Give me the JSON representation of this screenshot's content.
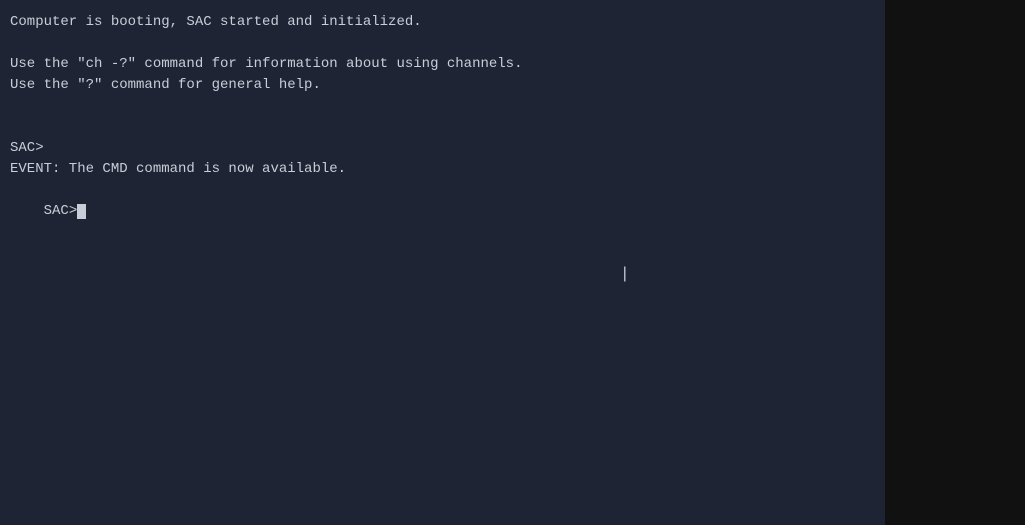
{
  "terminal": {
    "background": "#1e2433",
    "right_panel_background": "#111111",
    "lines": [
      {
        "id": "line1",
        "text": "Computer is booting, SAC started and initialized."
      },
      {
        "id": "line2",
        "text": ""
      },
      {
        "id": "line3",
        "text": "Use the \"ch -?\" command for information about using channels."
      },
      {
        "id": "line4",
        "text": "Use the \"?\" command for general help."
      },
      {
        "id": "line5",
        "text": ""
      },
      {
        "id": "line6",
        "text": ""
      },
      {
        "id": "line7",
        "text": "SAC>"
      },
      {
        "id": "line8",
        "text": "EVENT: The CMD command is now available."
      },
      {
        "id": "line9",
        "text": "SAC>",
        "has_cursor": true
      }
    ]
  }
}
